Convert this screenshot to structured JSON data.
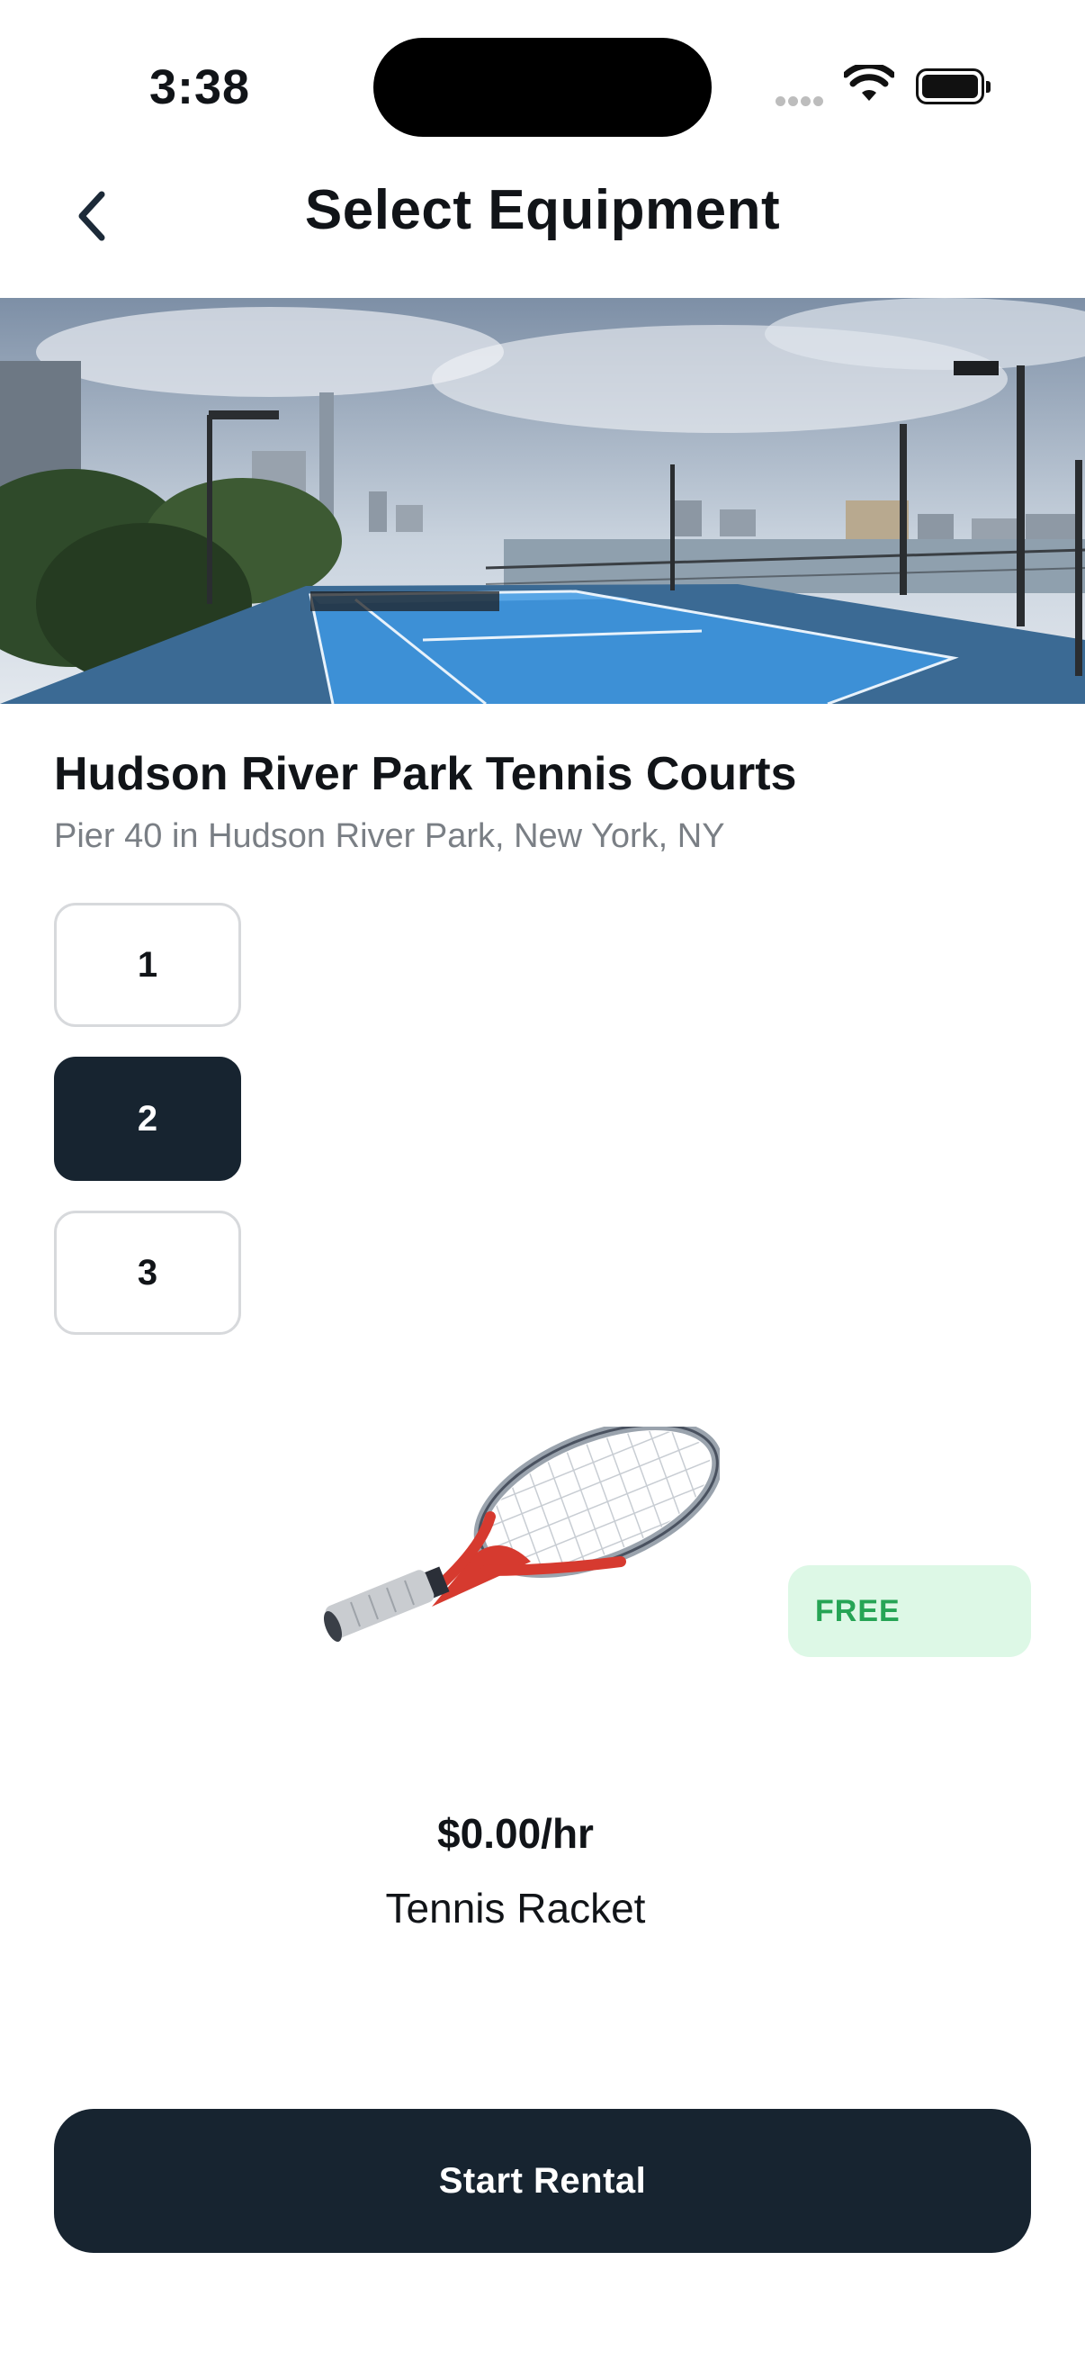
{
  "status_bar": {
    "time": "3:38"
  },
  "header": {
    "title": "Select Equipment",
    "back_icon": "chevron-left-icon"
  },
  "venue": {
    "name": "Hudson River Park Tennis Courts",
    "address": "Pier 40 in Hudson River Park, New York, NY"
  },
  "options": [
    {
      "label": "1",
      "selected": false
    },
    {
      "label": "2",
      "selected": true
    },
    {
      "label": "3",
      "selected": false
    }
  ],
  "equipment": {
    "badge": "FREE",
    "price": "$0.00/hr",
    "name": "Tennis Racket"
  },
  "cta": {
    "label": "Start Rental"
  },
  "colors": {
    "primary_dark": "#172430",
    "badge_bg": "#ddf8e6",
    "badge_text": "#26a455",
    "subtle_text": "#7a7f85"
  }
}
